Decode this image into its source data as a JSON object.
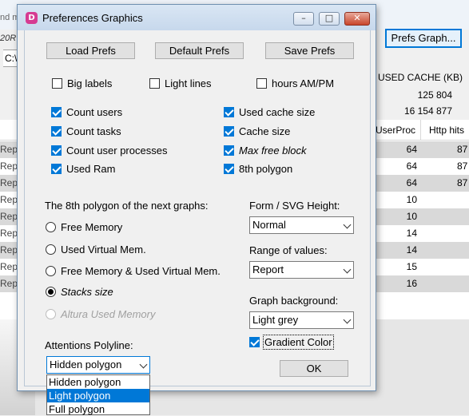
{
  "background_window": {
    "left_fragments": [
      "nd m",
      "20R",
      "C:\\"
    ],
    "prefs_graph_button": "Prefs Graph...",
    "cache_header": "USED CACHE (KB)",
    "cache_values": [
      "125 804",
      "16 154 877"
    ],
    "columns": [
      "UserProc",
      "Http hits"
    ],
    "row_stub": "Repo",
    "rows": [
      {
        "userproc": "64",
        "hits": "87"
      },
      {
        "userproc": "64",
        "hits": "87"
      },
      {
        "userproc": "64",
        "hits": "87"
      },
      {
        "userproc": "10",
        "hits": ""
      },
      {
        "userproc": "10",
        "hits": ""
      },
      {
        "userproc": "14",
        "hits": ""
      },
      {
        "userproc": "14",
        "hits": ""
      },
      {
        "userproc": "15",
        "hits": ""
      },
      {
        "userproc": "16",
        "hits": ""
      }
    ]
  },
  "dialog": {
    "title": "Preferences Graphics",
    "app_icon_letter": "D",
    "title_buttons": {
      "minimize": "–",
      "maximize": "□",
      "close": "✕"
    },
    "buttons": {
      "load": "Load Prefs",
      "default": "Default Prefs",
      "save": "Save Prefs",
      "ok": "OK"
    },
    "options_top": [
      {
        "label": "Big labels",
        "checked": false
      },
      {
        "label": "Light lines",
        "checked": false
      },
      {
        "label": "hours AM/PM",
        "checked": false
      }
    ],
    "counts_left": [
      {
        "label": "Count users",
        "checked": true
      },
      {
        "label": "Count tasks",
        "checked": true
      },
      {
        "label": "Count user processes",
        "checked": true
      },
      {
        "label": "Used Ram",
        "checked": true
      }
    ],
    "counts_right": [
      {
        "label": "Used cache size",
        "checked": true,
        "italic": false
      },
      {
        "label": "Cache size",
        "checked": true,
        "italic": false
      },
      {
        "label": "Max free block",
        "checked": true,
        "italic": true
      },
      {
        "label": "8th polygon",
        "checked": true,
        "italic": false
      }
    ],
    "polygon_group": {
      "label": "The 8th polygon of the next graphs:",
      "options": [
        {
          "label": "Free Memory",
          "selected": false,
          "disabled": false,
          "italic": false
        },
        {
          "label": "Used Virtual Mem.",
          "selected": false,
          "disabled": false,
          "italic": false
        },
        {
          "label": "Free Memory & Used Virtual Mem.",
          "selected": false,
          "disabled": false,
          "italic": false
        },
        {
          "label": "Stacks size",
          "selected": true,
          "disabled": false,
          "italic": true
        },
        {
          "label": "Altura Used Memory",
          "selected": false,
          "disabled": true,
          "italic": true
        }
      ]
    },
    "form_height": {
      "label": "Form / SVG Height:",
      "value": "Normal"
    },
    "range": {
      "label": "Range of values:",
      "value": "Report"
    },
    "graph_bg": {
      "label": "Graph background:",
      "value": "Light grey"
    },
    "gradient": {
      "label": "Gradient Color",
      "checked": true
    },
    "attentions": {
      "label": "Attentions Polyline:",
      "value": "Hidden polygon",
      "options": [
        "Hidden polygon",
        "Light polygon",
        "Full polygon"
      ],
      "highlighted_index": 1
    }
  },
  "colors": {
    "accent": "#0078d7",
    "row_alt": "#d9d9d9",
    "dialog_bg": "#f0f0f0"
  }
}
